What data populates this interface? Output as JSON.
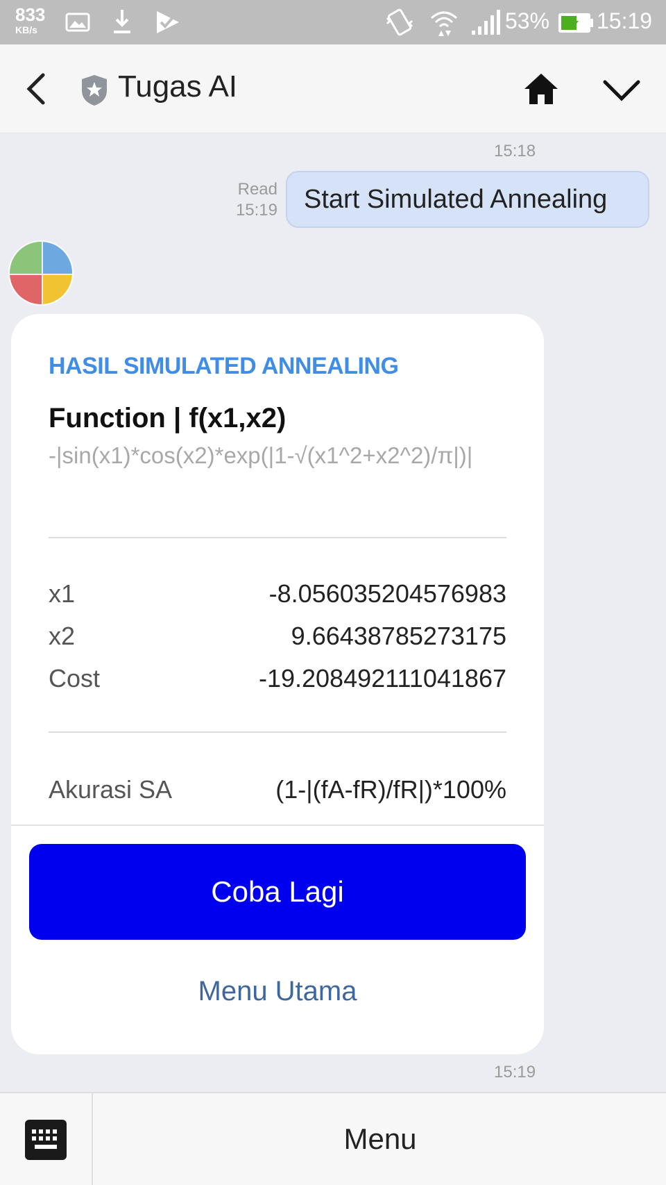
{
  "status_bar": {
    "speed_value": "833",
    "speed_unit": "KB/s",
    "battery": "53%",
    "time": "15:19"
  },
  "header": {
    "title": "Tugas AI"
  },
  "chat": {
    "time_top": "15:18",
    "outgoing": {
      "read_label": "Read",
      "read_time": "15:19",
      "text": "Start Simulated Annealing"
    },
    "card": {
      "section_title": "HASIL SIMULATED ANNEALING",
      "function_title": "Function | f(x1,x2)",
      "function_expr": "-|sin(x1)*cos(x2)*exp(|1-√(x1^2+x2^2)/π|)|",
      "rows": [
        {
          "label": "x1",
          "value": "-8.056035204576983"
        },
        {
          "label": "x2",
          "value": "9.66438785273175"
        },
        {
          "label": "Cost",
          "value": "-19.208492111041867"
        }
      ],
      "accuracy": {
        "label": "Akurasi SA",
        "value": "(1-|(fA-fR)/fR|)*100%"
      },
      "primary_button": "Coba Lagi",
      "secondary_button": "Menu Utama"
    },
    "time_bottom": "15:19"
  },
  "bottom_bar": {
    "menu_label": "Menu"
  },
  "colors": {
    "accent_title": "#3f8de6",
    "primary_button": "#0000ee",
    "link": "#3e679e",
    "outgoing_bubble": "#d6e2f7"
  }
}
